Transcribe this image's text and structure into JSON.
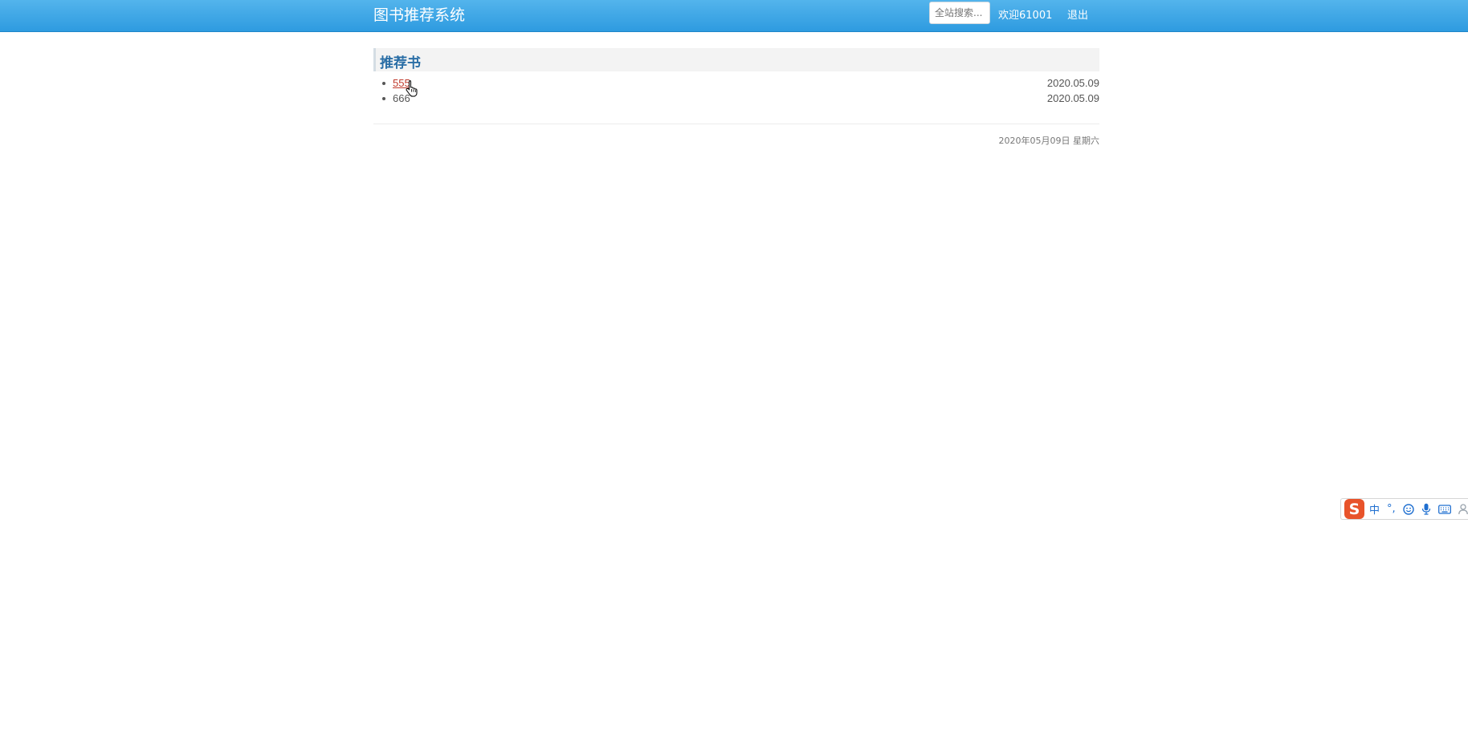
{
  "header": {
    "brand": "图书推荐系统",
    "search_placeholder": "全站搜索...",
    "welcome_text": "欢迎61001",
    "logout_label": "退出"
  },
  "section": {
    "title": "推荐书",
    "books": [
      {
        "title": "555",
        "date": "2020.05.09"
      },
      {
        "title": "666",
        "date": "2020.05.09"
      }
    ]
  },
  "footer": {
    "date_text": "2020年05月09日 星期六"
  },
  "ime_toolbar": {
    "logo_text": "S",
    "mode_label": "中",
    "punct_label": "°,"
  },
  "colors": {
    "header_bg": "#3aa6e6",
    "section_title": "#2a6ea6",
    "link_hover": "#c0392b"
  }
}
